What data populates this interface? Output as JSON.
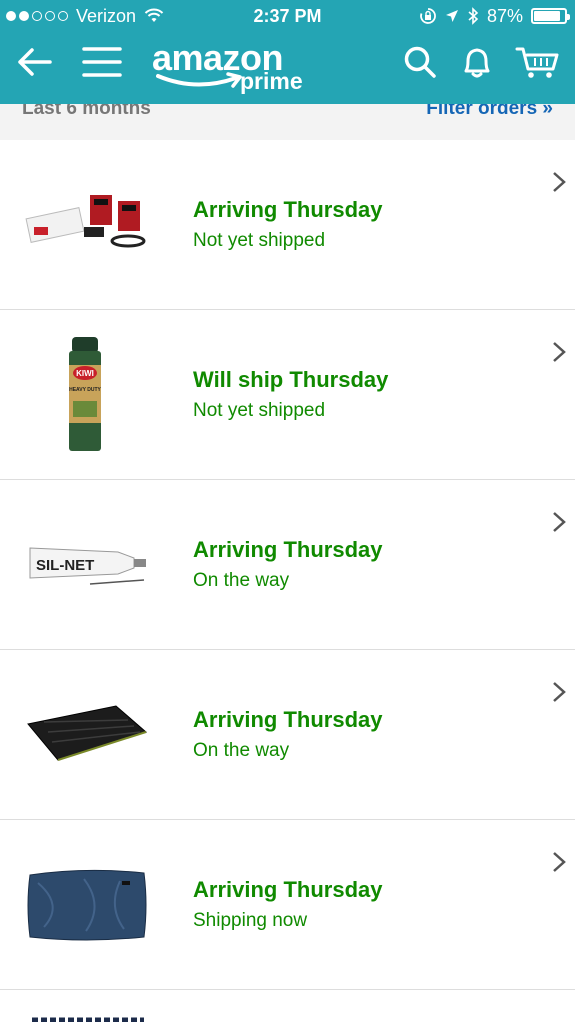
{
  "status_bar": {
    "carrier": "Verizon",
    "time": "2:37 PM",
    "battery": "87%",
    "battery_level": 0.87,
    "signal_bars_filled": 2,
    "signal_bars_total": 5
  },
  "header": {
    "logo_main": "amazon",
    "logo_sub": "prime",
    "background": "#24a5b4",
    "icons": [
      "back-arrow-icon",
      "hamburger-menu-icon",
      "search-icon",
      "bell-icon",
      "cart-icon"
    ]
  },
  "filter": {
    "range": "Last 6 months",
    "link": "Filter orders »"
  },
  "orders": [
    {
      "status": "Arriving Thursday",
      "substatus": "Not yet shipped",
      "product_icon": "electronics-kit-thumbnail"
    },
    {
      "status": "Will ship Thursday",
      "substatus": "Not yet shipped",
      "product_icon": "spray-can-thumbnail",
      "brand": "KIWI",
      "label": "HEAVY DUTY"
    },
    {
      "status": "Arriving Thursday",
      "substatus": "On the way",
      "product_icon": "seam-sealer-tube-thumbnail",
      "brand": "SIL-NET"
    },
    {
      "status": "Arriving Thursday",
      "substatus": "On the way",
      "product_icon": "sleeping-pad-thumbnail"
    },
    {
      "status": "Arriving Thursday",
      "substatus": "Shipping now",
      "product_icon": "pillow-thumbnail"
    }
  ],
  "colors": {
    "status_green": "#108a00",
    "link_blue": "#1566b5",
    "filter_bg": "#f3f3f3"
  }
}
